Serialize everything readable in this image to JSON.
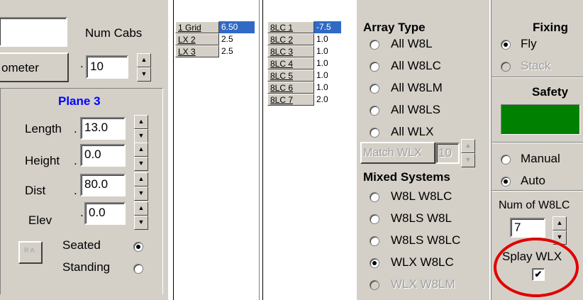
{
  "left_panel": {
    "num_cabs_label": "Num Cabs",
    "num_cabs_value": "10",
    "num_cabs_dot": ".",
    "top_input_value": "",
    "ometer_button": "ometer",
    "plane_title": "Plane 3",
    "fields": [
      {
        "label": "Length",
        "value": "13.0"
      },
      {
        "label": "Height",
        "value": "0.0"
      },
      {
        "label": "Dist",
        "value": "80.0"
      },
      {
        "label": "Elev",
        "value": "0.0"
      }
    ],
    "dot": ".",
    "ra_button": "R A",
    "seated_label": "Seated",
    "standing_label": "Standing",
    "seated_selected": true
  },
  "grid1": {
    "rows": [
      {
        "name": "1 Grid",
        "value": "6.50",
        "selected": true
      },
      {
        "name": "LX 2",
        "value": "2.5"
      },
      {
        "name": "LX 3",
        "value": "2.5"
      }
    ]
  },
  "grid2": {
    "rows": [
      {
        "name": "8LC 1",
        "value": "-7.5",
        "selected": true
      },
      {
        "name": "8LC 2",
        "value": "1.0"
      },
      {
        "name": "8LC 3",
        "value": "1.0"
      },
      {
        "name": "8LC 4",
        "value": "1.0"
      },
      {
        "name": "8LC 5",
        "value": "1.0"
      },
      {
        "name": "8LC 6",
        "value": "1.0"
      },
      {
        "name": "8LC 7",
        "value": "2.0"
      }
    ]
  },
  "array_type": {
    "title": "Array Type",
    "options": [
      "All W8L",
      "All W8LC",
      "All W8LM",
      "All W8LS",
      "All WLX"
    ],
    "match_button": "Match WLX",
    "match_value": "10",
    "mixed_title": "Mixed Systems",
    "mixed_options": [
      "W8L W8LC",
      "W8LS W8L",
      "W8LS W8LC",
      "WLX W8LC",
      "WLX W8LM"
    ],
    "mixed_selected": "WLX W8LC"
  },
  "right_panel": {
    "fixing_title": "Fixing",
    "fly_label": "Fly",
    "stack_label": "Stack",
    "safety_title": "Safety",
    "safety_color": "#008000",
    "manual_label": "Manual",
    "auto_label": "Auto",
    "num_label": "Num of W8LC",
    "num_value": "7",
    "splay_label": "Splay WLX",
    "splay_checked": true,
    "annotation_color": "#e00000"
  }
}
